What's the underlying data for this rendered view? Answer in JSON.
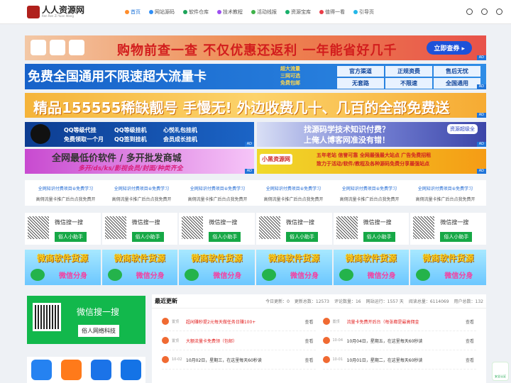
{
  "header": {
    "logo": "人人资源网",
    "logo_sub": "Ren Ren Zi Yuan Wang",
    "nav": [
      {
        "label": "首页",
        "active": true,
        "color": "#ff8d2b"
      },
      {
        "label": "网站源码",
        "color": "#2f8ef5"
      },
      {
        "label": "软件仓库",
        "color": "#1da45a"
      },
      {
        "label": "技术教程",
        "color": "#9d4ff0"
      },
      {
        "label": "活动线报",
        "color": "#3fb249"
      },
      {
        "label": "资源宝库",
        "color": "#18b06b"
      },
      {
        "label": "值得一看",
        "color": "#ea3b47"
      },
      {
        "label": "引导页",
        "color": "#23b7e8"
      }
    ]
  },
  "banners": {
    "b1": {
      "text": "购物前查一查 不仅优惠还返利 一年能省好几千",
      "cta": "立即查券 ▸",
      "ad": "AD"
    },
    "b2": {
      "prefix": "免费",
      "text": "全国通用不限速超大流量卡",
      "mid": [
        "超大流量",
        "三网可选",
        "免费包邮"
      ],
      "right": [
        "官方渠道",
        "正规资费",
        "售后无忧",
        "无套路",
        "不限速",
        "全国通用"
      ],
      "ad": "AD"
    },
    "b3": {
      "text": "精品155555稀缺靓号 手慢无! 外边收费几十、几百的全部免费送",
      "ad": "AD"
    },
    "b4": {
      "items": [
        "QQ等级代挂",
        "QQ等级挂机",
        "心悦礼包挂机",
        "免费领取一个月",
        "QQ签到挂机",
        "会员成长挂机"
      ],
      "ad": "AD"
    },
    "b5": {
      "line1": "找源码学技术知识付费？",
      "line2": "上俺人博客网准没有错！",
      "tag": "资源超级全",
      "ad": "AD"
    },
    "b6": {
      "line1": "全网最低价软件 / 多开批发商城",
      "line2": "多开/ds/ks/影视会员/封面/种类齐全",
      "ad": "AD"
    },
    "b7": {
      "logo": "小黑资源网",
      "line1": "五年老站 信誉可靠 全网最强最大站点 广告免费招租",
      "line2": "致力于活动/软件/教程及各种源码免费分享最强站点",
      "ad": "AD"
    }
  },
  "links": [
    [
      "全网知识付费项目⑧免费学习",
      "全网知识付费项目⑧免费学习",
      "全网知识付费项目⑧免费学习",
      "全网知识付费项目⑧免费学习",
      "全网知识付费项目⑧免费学习",
      "全网知识付费项目⑧免费学习"
    ],
    [
      "高佣流量卡推广后台点我免费开",
      "高佣流量卡推广后台点我免费开",
      "高佣流量卡推广后台点我免费开",
      "高佣流量卡推广后台点我免费开",
      "高佣流量卡推广后台点我免费开",
      "高佣流量卡推广后台点我免费开"
    ]
  ],
  "wechat_ads": [
    {
      "search": "微信搜一搜",
      "btn": "俗人小助手"
    },
    {
      "search": "微信搜一搜",
      "btn": "俗人小助手"
    },
    {
      "search": "微信搜一搜",
      "btn": "俗人小助手"
    },
    {
      "search": "微信搜一搜",
      "btn": "俗人小助手"
    },
    {
      "search": "微信搜一搜",
      "btn": "俗人小助手"
    },
    {
      "search": "微信搜一搜",
      "btn": "俗人小助手"
    }
  ],
  "software_ads": [
    {
      "title": "微商软件货源",
      "sub": "微信分身"
    },
    {
      "title": "微商软件货源",
      "sub": "微信分身"
    },
    {
      "title": "微商软件货源",
      "sub": "微信分身"
    },
    {
      "title": "微商软件货源",
      "sub": "微信分身"
    },
    {
      "title": "微商软件货源",
      "sub": "微信分身"
    },
    {
      "title": "微商软件货源",
      "sub": "微信分身"
    }
  ],
  "sidebar": {
    "search": "微信搜一搜",
    "name": "俗人网络科技"
  },
  "main": {
    "title": "最近更新",
    "stats": [
      "今日更新：0",
      "更新总数：12573",
      "评论数量：16",
      "网站运行：1557 天",
      "阅读总量：6114069",
      "用户总数：132"
    ]
  },
  "posts": [
    {
      "date": "置顶",
      "title": "超闲赚秒提2元每天做任务日赚100+",
      "views": "查看",
      "red": true
    },
    {
      "date": "置顶",
      "title": "流量卡免费开后台（每张都是最高佣金",
      "views": "查看",
      "red": true
    },
    {
      "date": "置顶",
      "title": "大额流量卡免费领（包邮）",
      "views": "查看",
      "red": true
    },
    {
      "date": "10-04",
      "title": "10月04日，星期五，在这里每天60秒读",
      "views": "查看",
      "red": false
    },
    {
      "date": "10-02",
      "title": "10月02日，星期三，在这里每天60秒读",
      "views": "查看",
      "red": false
    },
    {
      "date": "10-01",
      "title": "10月01日，星期二，在这里每天60秒读",
      "views": "查看",
      "red": false
    }
  ],
  "safe": "安全认证"
}
